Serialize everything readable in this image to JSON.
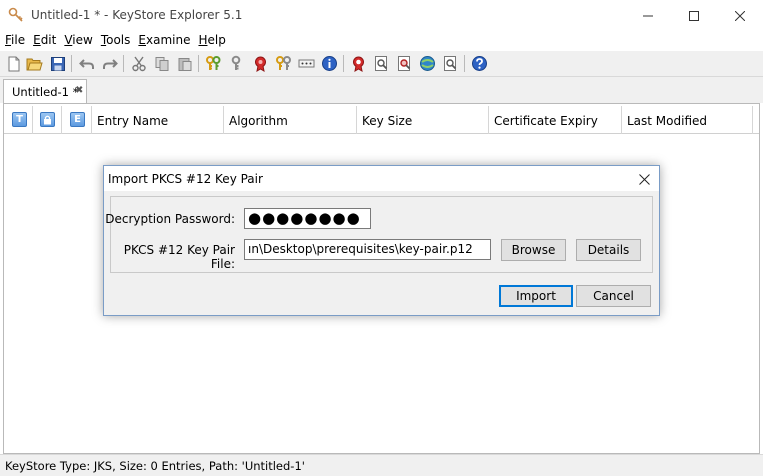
{
  "window": {
    "title": "Untitled-1 * - KeyStore Explorer 5.1"
  },
  "menu": {
    "items": [
      {
        "label": "File",
        "mnemonic": "F",
        "rest": "ile"
      },
      {
        "label": "Edit",
        "mnemonic": "E",
        "rest": "dit"
      },
      {
        "label": "View",
        "mnemonic": "V",
        "rest": "iew"
      },
      {
        "label": "Tools",
        "mnemonic": "T",
        "rest": "ools"
      },
      {
        "label": "Examine",
        "mnemonic": "E",
        "rest": "xamine"
      },
      {
        "label": "Help",
        "mnemonic": "H",
        "rest": "elp"
      }
    ]
  },
  "toolbar": {
    "icons": [
      "new-file-icon",
      "open-folder-icon",
      "save-icon",
      "undo-icon",
      "redo-icon",
      "cut-icon",
      "copy-icon",
      "paste-icon",
      "generate-key-pair-icon",
      "generate-secret-key-icon",
      "import-trusted-certificate-icon",
      "import-key-pair-icon",
      "set-password-icon",
      "properties-icon",
      "examine-certificate-icon",
      "examine-crl-icon",
      "examine-csr-icon",
      "examine-ssl-icon",
      "examine-clipboard-icon",
      "help-icon"
    ]
  },
  "tabs": [
    {
      "label": "Untitled-1 *"
    }
  ],
  "table": {
    "type_columns": [
      "T",
      "",
      "E"
    ],
    "columns": [
      "Entry Name",
      "Algorithm",
      "Key Size",
      "Certificate Expiry",
      "Last Modified"
    ],
    "rows": []
  },
  "status": {
    "text": "KeyStore Type: JKS, Size: 0 Entries, Path: 'Untitled-1'"
  },
  "dialog": {
    "title": "Import PKCS #12 Key Pair",
    "password_label": "Decryption Password:",
    "password_value": "●●●●●●●●",
    "file_label": "PKCS #12 Key Pair File:",
    "file_value": "ın\\Desktop\\prerequisites\\key-pair.p12",
    "browse_label": "Browse",
    "details_label": "Details",
    "import_label": "Import",
    "cancel_label": "Cancel"
  },
  "colors": {
    "accent": "#0078d7",
    "toolbar_bg": "#f0f0f0"
  }
}
